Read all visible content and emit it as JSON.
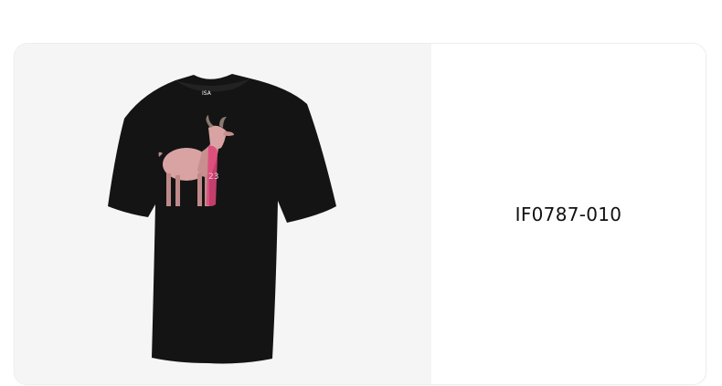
{
  "product": {
    "image_alt": "Black t-shirt with goat graphic",
    "sku": "IF0787-010"
  },
  "colors": {
    "shirt": "#141414",
    "goat": "#d9a3a3",
    "accent": "#e0457b",
    "image_bg": "#f5f5f5"
  }
}
